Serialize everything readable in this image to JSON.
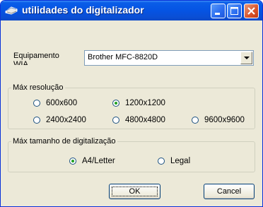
{
  "window": {
    "title": "utilidades do digitalizador",
    "title_icon": "scanner-icon",
    "controls": [
      "minimize-icon",
      "maximize-icon",
      "close-icon"
    ]
  },
  "device": {
    "label_line1": "Equipamento",
    "label_line2": "WIA",
    "selected": "Brother MFC-8820D"
  },
  "resolution": {
    "legend": "Máx resolução",
    "options": [
      {
        "label": "600x600",
        "selected": false
      },
      {
        "label": "1200x1200",
        "selected": true
      },
      {
        "label": "2400x2400",
        "selected": false
      },
      {
        "label": "4800x4800",
        "selected": false
      },
      {
        "label": "9600x9600",
        "selected": false
      }
    ]
  },
  "scan_size": {
    "legend": "Máx tamanho de digitalização",
    "options": [
      {
        "label": "A4/Letter",
        "selected": true
      },
      {
        "label": "Legal",
        "selected": false
      }
    ]
  },
  "buttons": {
    "ok": "OK",
    "cancel": "Cancel"
  },
  "colors": {
    "titlebar": "#0554e3",
    "face": "#ece9d8",
    "close_button": "#d9532a"
  }
}
